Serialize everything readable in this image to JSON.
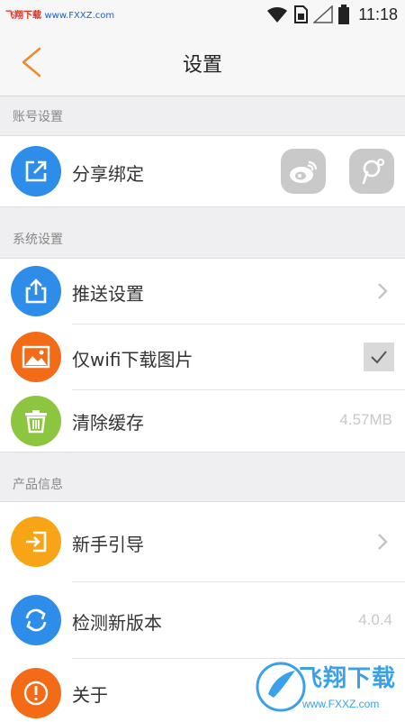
{
  "watermark": {
    "top_text": "飞翔下载",
    "top_url": "www.FXXZ.com",
    "brand": "飞翔下载",
    "url": "www.FXXZ.com"
  },
  "status_bar": {
    "time": "11:18",
    "icons": [
      "wifi-icon",
      "sim-icon",
      "signal-icon",
      "battery-icon"
    ]
  },
  "nav": {
    "title": "设置",
    "back_icon": "chevron-left-icon",
    "accent": "#f08a28"
  },
  "sections": {
    "account": "账号设置",
    "system": "系统设置",
    "product": "产品信息"
  },
  "rows": {
    "share": {
      "label": "分享绑定",
      "icon": "share-external-icon",
      "color": "#2d8de8",
      "bind_buttons": [
        "weibo-icon",
        "tencent-weibo-icon"
      ]
    },
    "push": {
      "label": "推送设置",
      "icon": "upload-share-icon",
      "color": "#2d8de8"
    },
    "wifi": {
      "label": "仅wifi下载图片",
      "icon": "image-icon",
      "color": "#f36a17",
      "checked": true
    },
    "cache": {
      "label": "清除缓存",
      "value": "4.57MB",
      "icon": "trash-icon",
      "color": "#8cc63f"
    },
    "guide": {
      "label": "新手引导",
      "icon": "login-arrow-icon",
      "color": "#f7a516"
    },
    "update": {
      "label": "检测新版本",
      "value": "4.0.4",
      "icon": "refresh-icon",
      "color": "#2d8de8"
    },
    "about": {
      "label": "关于",
      "icon": "info-exclamation-icon",
      "color": "#f36a17"
    }
  }
}
